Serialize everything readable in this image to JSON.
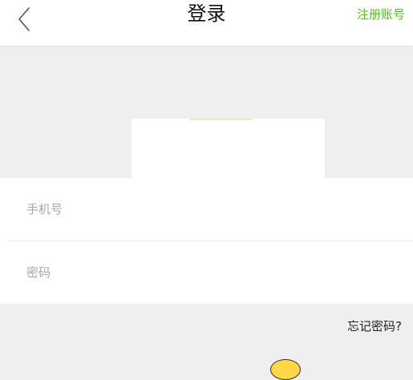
{
  "header": {
    "title": "登录",
    "register_label": "注册账号"
  },
  "form": {
    "phone_placeholder": "手机号",
    "password_placeholder": "密码"
  },
  "links": {
    "forgot_password": "忘记密码?"
  },
  "icons": {
    "back": "chevron-left-icon",
    "mascot": "mascot-icon"
  },
  "colors": {
    "accent": "#5cb82e",
    "background": "#efefef"
  }
}
